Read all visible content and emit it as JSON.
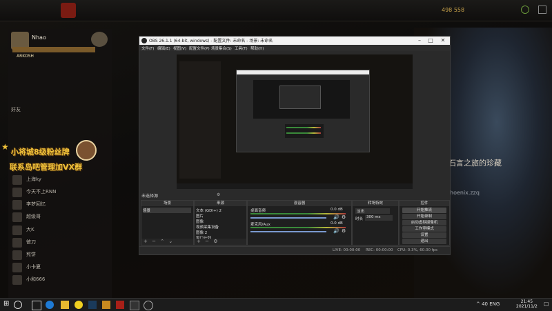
{
  "dota": {
    "nav": [
      "",
      "",
      "",
      "",
      "",
      ""
    ],
    "currency": "498 558",
    "profile_name": "Nhao",
    "profile_tag": "ARKOSH",
    "friends_header": "好友",
    "friends": [
      {
        "name": "上海ky"
      },
      {
        "name": "今天不上RNN"
      },
      {
        "name": "李梦回忆"
      },
      {
        "name": "超级哥"
      },
      {
        "name": "大K"
      },
      {
        "name": "彼刀"
      },
      {
        "name": "煎饼"
      },
      {
        "name": "小卡夏"
      },
      {
        "name": "小和666"
      }
    ],
    "hero_title": "石言之旅的珍藏",
    "hero_subtitle": "hoenix.zzq"
  },
  "sticker": {
    "line1": "小将城8级粉丝牌",
    "line2": "联系岛吧管理加VX群"
  },
  "obs": {
    "title": "OBS 26.1.1 (64-bit, windows) - 配置文件: 未命名 - 场景: 未命名",
    "menu": [
      "文件(F)",
      "编辑(E)",
      "视图(V)",
      "配置文件(P)",
      "场景集合(S)",
      "工具(T)",
      "帮助(H)"
    ],
    "scene_label": "未选择源",
    "panels": {
      "scenes": "场景",
      "sources": "来源",
      "mixer": "混音器",
      "transitions": "转场特效",
      "controls": "控件"
    },
    "scenes": [
      "场景"
    ],
    "sources": [
      "文本 (GDI+) 2",
      "图片",
      "图像",
      "视频采集设备",
      "图像 2",
      "窗口计划"
    ],
    "mixer": [
      {
        "name": "桌面音频",
        "level": "0.0 dB"
      },
      {
        "name": "麦克风/Aux",
        "level": "0.0 dB"
      }
    ],
    "transition": {
      "type": "淡出",
      "duration_label": "时长",
      "duration": "300 ms"
    },
    "controls": [
      "开始推流",
      "开始录制",
      "启动虚拟摄像机",
      "工作室模式",
      "设置",
      "退出"
    ],
    "status": {
      "live": "LIVE: 00:00:00",
      "rec": "REC: 00:00:00",
      "cpu": "CPU: 0.3%, 60.00 fps"
    }
  },
  "taskbar": {
    "time": "21:45",
    "date": "2021/11/2",
    "tray": "^ 40 ENG"
  }
}
